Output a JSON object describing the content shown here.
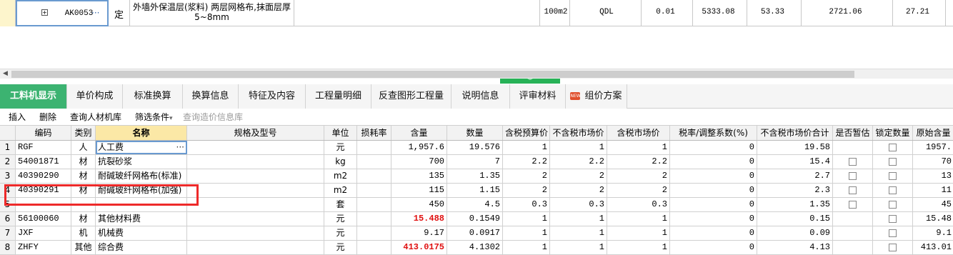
{
  "top_row": {
    "code": "AK0053",
    "ellipsis": "···",
    "category": "定",
    "name": "外墙外保温层(浆料) 两层网格布,抹面层厚5~8mm",
    "unit": "100m2",
    "qty_expr": "QDL",
    "quantity": "0.01",
    "unit_price": "5333.08",
    "sum": "53.33",
    "v2": "2721.06",
    "v3": "27.21"
  },
  "splitter_arrow": "︾",
  "tabs": [
    "工料机显示",
    "单价构成",
    "标准换算",
    "换算信息",
    "特征及内容",
    "工程量明细",
    "反查图形工程量",
    "说明信息",
    "评审材料",
    "组价方案"
  ],
  "tab_new_badge": "NEW",
  "toolbar": {
    "insert": "插入",
    "delete": "删除",
    "query_material": "查询人材机库",
    "filter": "筛选条件",
    "filter_arrow": "▾",
    "query_price": "查询造价信息库"
  },
  "columns": [
    "编码",
    "类别",
    "名称",
    "规格及型号",
    "单位",
    "损耗率",
    "含量",
    "数量",
    "含税预算价",
    "不含税市场价",
    "含税市场价",
    "税率/调整系数(%)",
    "不含税市场价合计",
    "是否暂估",
    "锁定数量",
    "原始含量"
  ],
  "rows": [
    {
      "n": "1",
      "code": "RGF",
      "type": "人",
      "name": "人工费",
      "spec": "",
      "unit": "元",
      "loss": "",
      "content": "1,957.6",
      "qty": "19.576",
      "p1": "1",
      "p2": "1",
      "p3": "1",
      "tax": "0",
      "total": "19.58",
      "est": false,
      "lock": true,
      "orig": "1957."
    },
    {
      "n": "2",
      "code": "54001871",
      "type": "材",
      "name": "抗裂砂浆",
      "spec": "",
      "unit": "kg",
      "loss": "",
      "content": "700",
      "qty": "7",
      "p1": "2.2",
      "p2": "2.2",
      "p3": "2.2",
      "tax": "0",
      "total": "15.4",
      "est": true,
      "lock": true,
      "orig": "70"
    },
    {
      "n": "3",
      "code": "40390290",
      "type": "材",
      "name": "耐碱玻纤网格布(标准)",
      "spec": "",
      "unit": "m2",
      "loss": "",
      "content": "135",
      "qty": "1.35",
      "p1": "2",
      "p2": "2",
      "p3": "2",
      "tax": "0",
      "total": "2.7",
      "est": true,
      "lock": true,
      "orig": "13"
    },
    {
      "n": "4",
      "code": "40390291",
      "type": "材",
      "name": "耐碱玻纤网格布(加强)",
      "spec": "",
      "unit": "m2",
      "loss": "",
      "content": "115",
      "qty": "1.15",
      "p1": "2",
      "p2": "2",
      "p3": "2",
      "tax": "0",
      "total": "2.3",
      "est": true,
      "lock": true,
      "orig": "11"
    },
    {
      "n": "5",
      "code": "",
      "type": "",
      "name": "",
      "spec": "",
      "unit": "套",
      "loss": "",
      "content": "450",
      "qty": "4.5",
      "p1": "0.3",
      "p2": "0.3",
      "p3": "0.3",
      "tax": "0",
      "total": "1.35",
      "est": true,
      "lock": true,
      "orig": "45"
    },
    {
      "n": "6",
      "code": "56100060",
      "type": "材",
      "name": "其他材料费",
      "spec": "",
      "unit": "元",
      "loss": "",
      "content": "15.488",
      "qty": "0.1549",
      "p1": "1",
      "p2": "1",
      "p3": "1",
      "tax": "0",
      "total": "0.15",
      "est": false,
      "lock": true,
      "orig": "15.48"
    },
    {
      "n": "7",
      "code": "JXF",
      "type": "机",
      "name": "机械费",
      "spec": "",
      "unit": "元",
      "loss": "",
      "content": "9.17",
      "qty": "0.0917",
      "p1": "1",
      "p2": "1",
      "p3": "1",
      "tax": "0",
      "total": "0.09",
      "est": false,
      "lock": true,
      "orig": "9.1"
    },
    {
      "n": "8",
      "code": "ZHFY",
      "type": "其他",
      "name": "综合费",
      "spec": "",
      "unit": "元",
      "loss": "",
      "content": "413.0175",
      "qty": "4.1302",
      "p1": "1",
      "p2": "1",
      "p3": "1",
      "tax": "0",
      "total": "4.13",
      "est": false,
      "lock": true,
      "orig": "413.01"
    }
  ],
  "red_content_rows": [
    5,
    7
  ],
  "colors": {
    "accent": "#3cb371",
    "highlight": "#ee2a2a",
    "name_header": "#fbe8a6"
  }
}
